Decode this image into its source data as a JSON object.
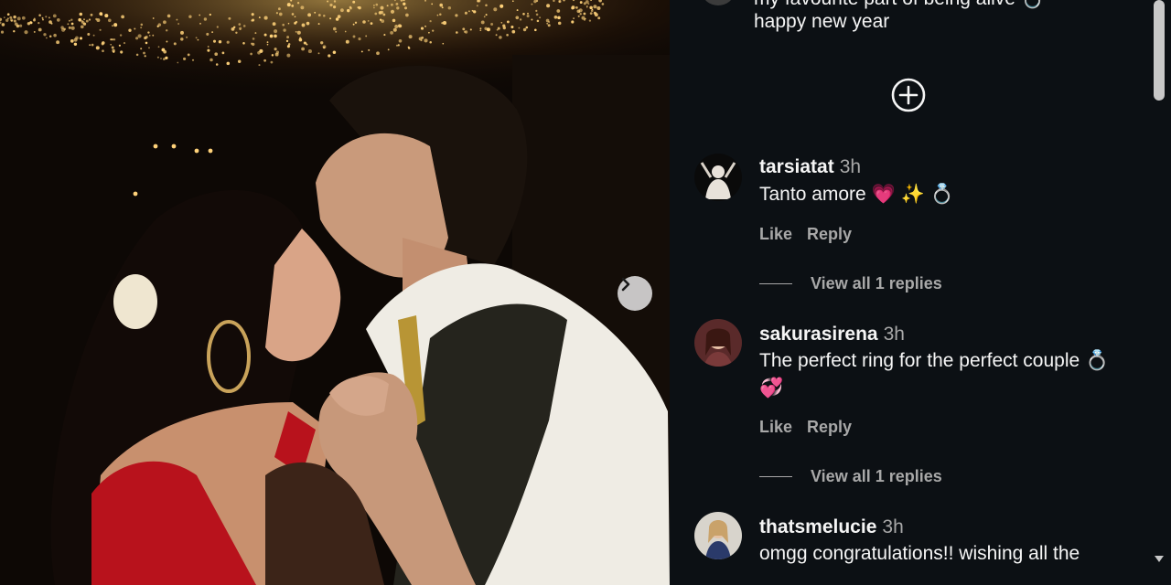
{
  "caption": {
    "line1": "my favourite part of being alive 💍",
    "line2": "happy new year"
  },
  "load_more_icon": "plus-circle-icon",
  "comments": [
    {
      "username": "tarsiatat",
      "time": "3h",
      "text": "Tanto amore 💗 ✨ 💍",
      "like": "Like",
      "reply": "Reply",
      "view_replies": "View all 1 replies"
    },
    {
      "username": "sakurasirena",
      "time": "3h",
      "text": "The perfect ring for the perfect couple 💍 💞",
      "like": "Like",
      "reply": "Reply",
      "view_replies": "View all 1 replies"
    },
    {
      "username": "thatsmelucie",
      "time": "3h",
      "text": "omgg congratulations!! wishing all the"
    }
  ],
  "photo": {
    "next_icon": "chevron-right-icon"
  },
  "colors": {
    "panel_bg": "#0c1014",
    "text": "#f5f5f5",
    "muted": "#a8a8a8"
  }
}
